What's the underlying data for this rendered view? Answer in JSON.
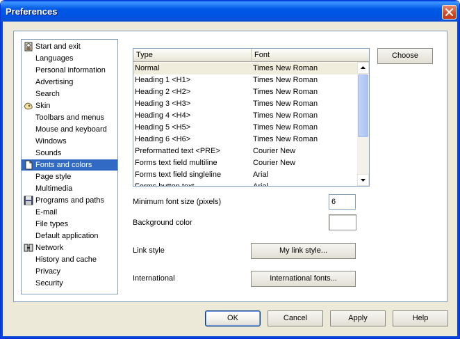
{
  "window": {
    "title": "Preferences"
  },
  "sidebar": {
    "items": [
      {
        "label": "Start and exit",
        "icon": "door-icon"
      },
      {
        "label": "Languages"
      },
      {
        "label": "Personal information"
      },
      {
        "label": "Advertising"
      },
      {
        "label": "Search"
      },
      {
        "label": "Skin",
        "icon": "skin-icon"
      },
      {
        "label": "Toolbars and menus"
      },
      {
        "label": "Mouse and keyboard"
      },
      {
        "label": "Windows"
      },
      {
        "label": "Sounds"
      },
      {
        "label": "Fonts and colors",
        "icon": "document-icon",
        "selected": true
      },
      {
        "label": "Page style"
      },
      {
        "label": "Multimedia"
      },
      {
        "label": "Programs and paths",
        "icon": "floppy-disk-icon"
      },
      {
        "label": "E-mail"
      },
      {
        "label": "File types"
      },
      {
        "label": "Default application"
      },
      {
        "label": "Network",
        "icon": "network-icon"
      },
      {
        "label": "History and cache"
      },
      {
        "label": "Privacy"
      },
      {
        "label": "Security"
      }
    ]
  },
  "fonts_table": {
    "headers": {
      "type": "Type",
      "font": "Font"
    },
    "rows": [
      {
        "type": "Normal",
        "font": "Times New Roman"
      },
      {
        "type": "Heading 1 <H1>",
        "font": "Times New Roman"
      },
      {
        "type": "Heading 2 <H2>",
        "font": "Times New Roman"
      },
      {
        "type": "Heading 3 <H3>",
        "font": "Times New Roman"
      },
      {
        "type": "Heading 4 <H4>",
        "font": "Times New Roman"
      },
      {
        "type": "Heading 5 <H5>",
        "font": "Times New Roman"
      },
      {
        "type": "Heading 6 <H6>",
        "font": "Times New Roman"
      },
      {
        "type": "Preformatted text <PRE>",
        "font": "Courier New"
      },
      {
        "type": "Forms text field multiline",
        "font": "Courier New"
      },
      {
        "type": "Forms text field singleline",
        "font": "Arial"
      },
      {
        "type": "Forms button text",
        "font": "Arial"
      }
    ]
  },
  "buttons": {
    "choose": "Choose",
    "link_style": "My link style...",
    "international_fonts": "International fonts...",
    "ok": "OK",
    "cancel": "Cancel",
    "apply": "Apply",
    "help": "Help"
  },
  "settings": {
    "min_font_label": "Minimum font size (pixels)",
    "min_font_value": "6",
    "background_color_label": "Background color",
    "background_color_value": "#ffffff",
    "link_style_label": "Link style",
    "international_label": "International"
  },
  "colors": {
    "selection": "#316ac5",
    "titlebar": "#0054e3",
    "dialog_bg": "#ece9d8"
  }
}
